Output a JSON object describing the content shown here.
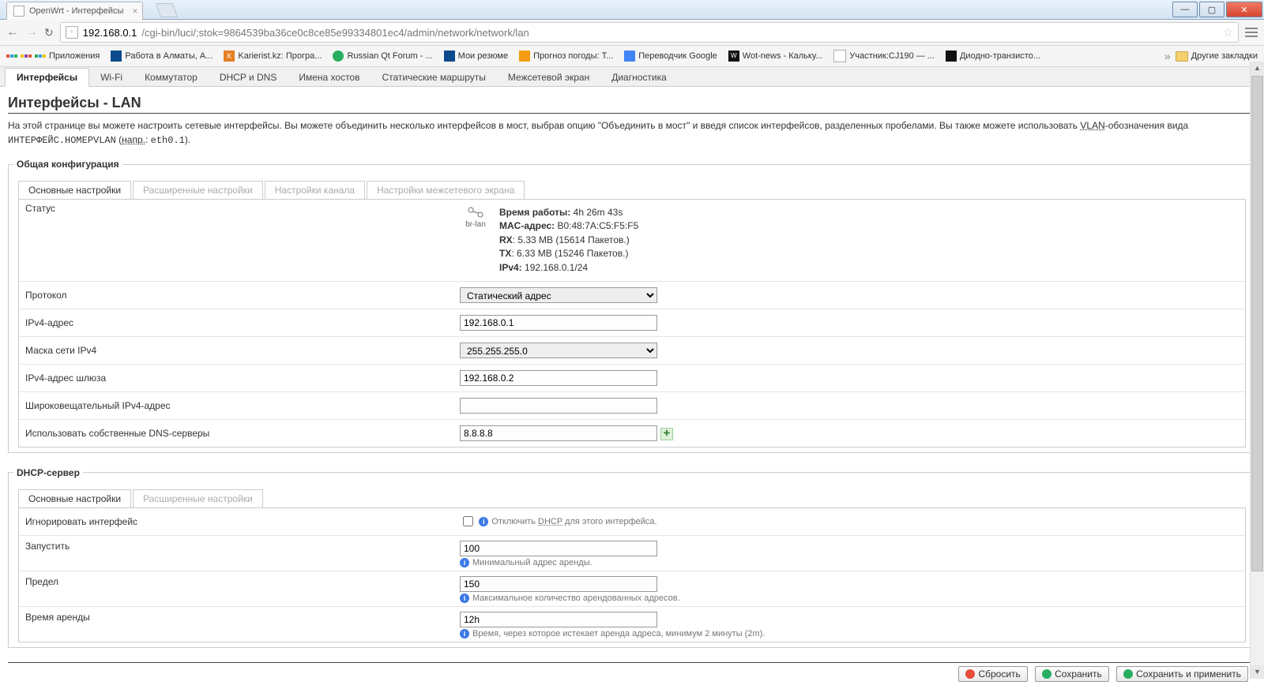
{
  "browser": {
    "tab_title": "OpenWrt - Интерфейсы",
    "url_host": "192.168.0.1",
    "url_path": "/cgi-bin/luci/;stok=9864539ba36ce0c8ce85e99334801ec4/admin/network/network/lan",
    "bookmarks_label": "Приложения",
    "bookmarks": [
      "Работа в Алматы, А...",
      "Karierist.kz: Програ...",
      "Russian Qt Forum - ...",
      "Мои резюме",
      "Прогноз погоды: Т...",
      "Переводчик Google",
      "Wot-news - Кальку...",
      "Участник:CJ190 — ...",
      "Диодно-транзисто..."
    ],
    "other_bookmarks": "Другие закладки"
  },
  "tabs": [
    "Интерфейсы",
    "Wi-Fi",
    "Коммутатор",
    "DHCP и DNS",
    "Имена хостов",
    "Статические маршруты",
    "Межсетевой экран",
    "Диагностика"
  ],
  "active_tab": 0,
  "page_title": "Интерфейсы - LAN",
  "description": {
    "text1": "На этой странице вы можете настроить сетевые интерфейсы. Вы можете объединить несколько интерфейсов в мост, выбрав опцию \"Объединить в мост\" и введя список интерфейсов, разделенных пробелами. Вы также можете использовать ",
    "vlan": "VLAN",
    "text2": "-обозначения вида ",
    "mono": "ИНТЕРФЕЙС.НОМЕРVLAN",
    "napr_label": "напр.",
    "napr_value": "eth0.1"
  },
  "general": {
    "legend": "Общая конфигурация",
    "sub_tabs": [
      "Основные настройки",
      "Расширенные настройки",
      "Настройки канала",
      "Настройки межсетевого экрана"
    ],
    "active_sub": 0,
    "status_label": "Статус",
    "iface_name": "br-lan",
    "status": {
      "uptime_label": "Время работы:",
      "uptime": "4h 26m 43s",
      "mac_label": "MAC-адрес:",
      "mac": "B0:48:7A:C5:F5:F5",
      "rx_label": "RX",
      "rx": ": 5.33 MB (15614 Пакетов.)",
      "tx_label": "TX",
      "tx": ": 6.33 MB (15246 Пакетов.)",
      "ipv4_label": "IPv4:",
      "ipv4": "192.168.0.1/24"
    },
    "protocol_label": "Протокол",
    "protocol_value": "Статический адрес",
    "ipv4_addr_label": "IPv4-адрес",
    "ipv4_addr_value": "192.168.0.1",
    "netmask_label": "Маска сети IPv4",
    "netmask_value": "255.255.255.0",
    "gateway_label": "IPv4-адрес шлюза",
    "gateway_value": "192.168.0.2",
    "broadcast_label": "Широковещательный IPv4-адрес",
    "broadcast_value": "",
    "dns_label": "Использовать собственные DNS-серверы",
    "dns_value": "8.8.8.8"
  },
  "dhcp": {
    "legend": "DHCP-сервер",
    "sub_tabs": [
      "Основные настройки",
      "Расширенные настройки"
    ],
    "active_sub": 0,
    "ignore_label": "Игнорировать интерфейс",
    "ignore_hint_pre": "Отключить ",
    "ignore_hint_mid": "DHCP",
    "ignore_hint_post": " для этого интерфейса.",
    "start_label": "Запустить",
    "start_value": "100",
    "start_hint": "Минимальный адрес аренды.",
    "limit_label": "Предел",
    "limit_value": "150",
    "limit_hint": "Максимальное количество арендованных адресов.",
    "lease_label": "Время аренды",
    "lease_value": "12h",
    "lease_hint_pre": "Время, через которое истекает аренда адреса, минимум 2 минуты (",
    "lease_hint_mono": "2m",
    "lease_hint_post": ")."
  },
  "buttons": {
    "reset": "Сбросить",
    "save": "Сохранить",
    "save_apply": "Сохранить и применить"
  }
}
